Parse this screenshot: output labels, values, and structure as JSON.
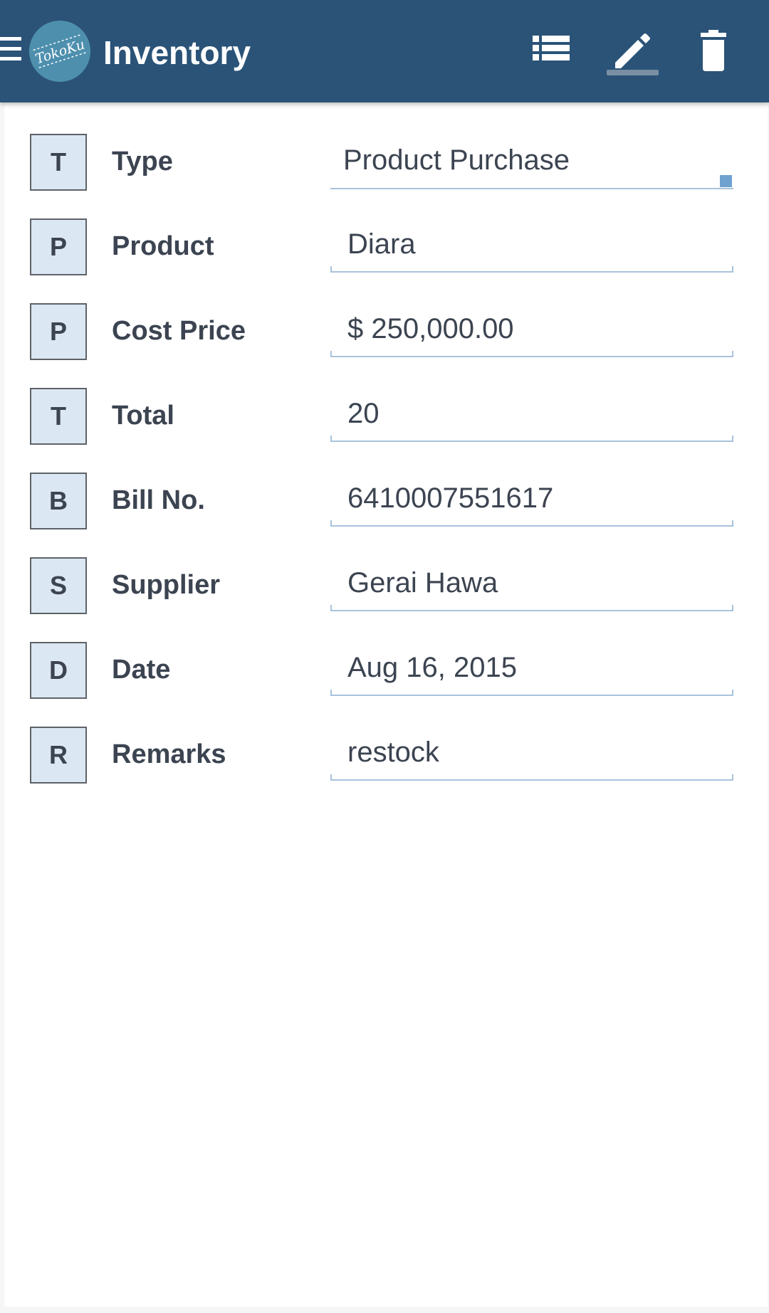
{
  "app": {
    "title": "Inventory",
    "logo_text": "TokoKu"
  },
  "toolbar": {
    "actions": [
      {
        "name": "list",
        "icon": "list-icon"
      },
      {
        "name": "edit",
        "icon": "pencil-icon",
        "active": true
      },
      {
        "name": "delete",
        "icon": "trash-icon"
      }
    ]
  },
  "form": {
    "fields": [
      {
        "badge": "T",
        "label": "Type",
        "value": "Product Purchase",
        "kind": "dropdown"
      },
      {
        "badge": "P",
        "label": "Product",
        "value": "Diara",
        "kind": "text"
      },
      {
        "badge": "P",
        "label": "Cost Price",
        "value": "$ 250,000.00",
        "kind": "text"
      },
      {
        "badge": "T",
        "label": "Total",
        "value": "20",
        "kind": "text"
      },
      {
        "badge": "B",
        "label": "Bill No.",
        "value": "6410007551617",
        "kind": "text"
      },
      {
        "badge": "S",
        "label": "Supplier",
        "value": "Gerai Hawa",
        "kind": "text"
      },
      {
        "badge": "D",
        "label": "Date",
        "value": "Aug 16, 2015",
        "kind": "text"
      },
      {
        "badge": "R",
        "label": "Remarks",
        "value": "restock",
        "kind": "text"
      }
    ]
  },
  "colors": {
    "appbar": "#2b5378",
    "badge_bg": "#dbe7f2",
    "text": "#3c4451",
    "underline": "#a9c3dc",
    "accent": "#6fa2cf"
  }
}
